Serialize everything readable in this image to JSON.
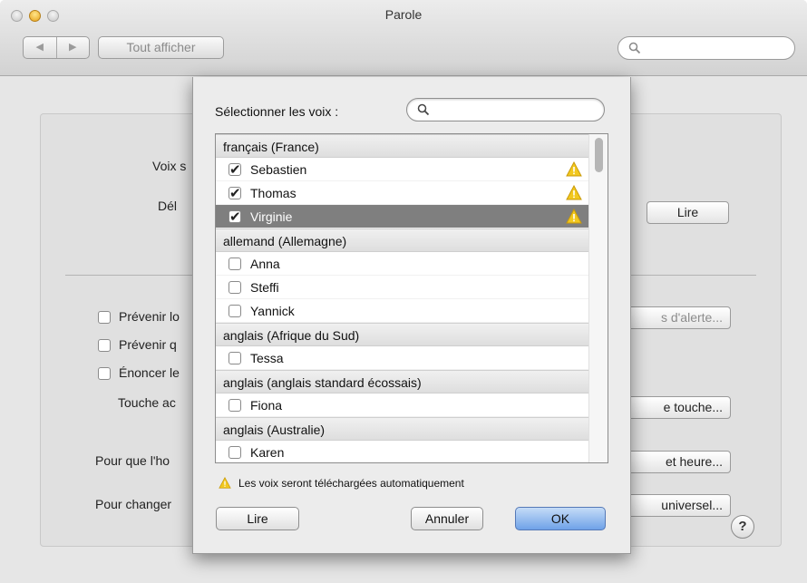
{
  "window": {
    "title": "Parole"
  },
  "toolbar": {
    "back_label": "◀",
    "forward_label": "▶",
    "show_all_label": "Tout afficher"
  },
  "background": {
    "voice_label": "Voix s",
    "rate_label": "Dél",
    "play_button": "Lire",
    "checkbox_1": "Prévenir lo",
    "checkbox_2": "Prévenir q",
    "checkbox_3": "Énoncer le",
    "shortcut_label": "Touche ac",
    "clock_label": "Pour que l'ho",
    "access_label": "Pour changer",
    "alert_button": "s d'alerte...",
    "key_button": "e touche...",
    "date_button": "et heure...",
    "universal_button": "universel..."
  },
  "sheet": {
    "select_label": "Sélectionner les voix :",
    "search_placeholder": "",
    "groups": [
      {
        "label": "français (France)",
        "items": [
          {
            "name": "Sebastien",
            "checked": true,
            "warning": true,
            "selected": false
          },
          {
            "name": "Thomas",
            "checked": true,
            "warning": true,
            "selected": false
          },
          {
            "name": "Virginie",
            "checked": true,
            "warning": true,
            "selected": true
          }
        ]
      },
      {
        "label": "allemand (Allemagne)",
        "items": [
          {
            "name": "Anna",
            "checked": false,
            "warning": false,
            "selected": false
          },
          {
            "name": "Steffi",
            "checked": false,
            "warning": false,
            "selected": false
          },
          {
            "name": "Yannick",
            "checked": false,
            "warning": false,
            "selected": false
          }
        ]
      },
      {
        "label": "anglais (Afrique du Sud)",
        "items": [
          {
            "name": "Tessa",
            "checked": false,
            "warning": false,
            "selected": false
          }
        ]
      },
      {
        "label": "anglais (anglais standard écossais)",
        "items": [
          {
            "name": "Fiona",
            "checked": false,
            "warning": false,
            "selected": false
          }
        ]
      },
      {
        "label": "anglais (Australie)",
        "items": [
          {
            "name": "Karen",
            "checked": false,
            "warning": false,
            "selected": false
          }
        ]
      }
    ],
    "note": "Les voix seront téléchargées automatiquement",
    "play_button": "Lire",
    "cancel_button": "Annuler",
    "ok_button": "OK"
  },
  "colors": {
    "selection": "#7f7f7f",
    "warning": "#f2c81e",
    "ok_button": "#6fa2e8"
  },
  "icons": [
    "close-window-icon",
    "minimize-window-icon",
    "zoom-window-icon",
    "search-icon",
    "warning-icon",
    "help-icon"
  ]
}
